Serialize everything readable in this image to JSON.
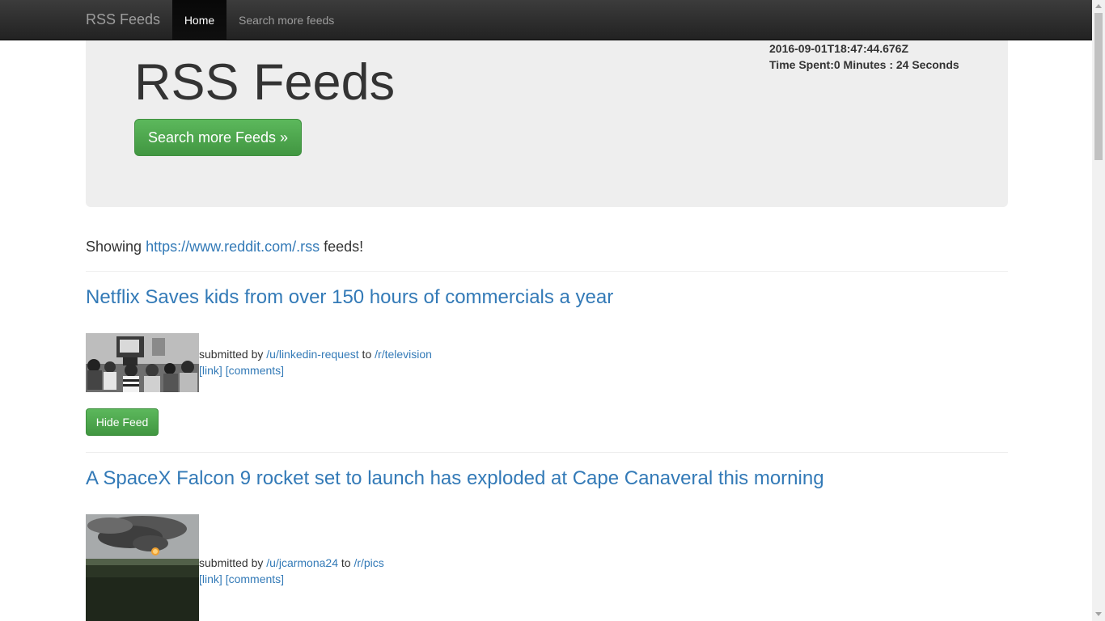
{
  "navbar": {
    "brand": "RSS Feeds",
    "home": "Home",
    "search": "Search more feeds"
  },
  "jumbotron": {
    "title": "RSS Feeds",
    "button": "Search more Feeds »",
    "timestamp": "2016-09-01T18:47:44.676Z",
    "time_spent": "Time Spent:0 Minutes : 24 Seconds"
  },
  "showing": {
    "prefix": "Showing ",
    "url": "https://www.reddit.com/.rss",
    "suffix": " feeds!"
  },
  "feeds": [
    {
      "title": "Netflix Saves kids from over 150 hours of commercials a year",
      "submitted_by": "submitted by ",
      "user": "/u/linkedin-request",
      "to": " to ",
      "subreddit": "/r/television",
      "link": "[link]",
      "comments": "[comments]",
      "hide": "Hide Feed",
      "thumbnail": "kids-watching-tv"
    },
    {
      "title": "A SpaceX Falcon 9 rocket set to launch has exploded at Cape Canaveral this morning",
      "submitted_by": "submitted by ",
      "user": "/u/jcarmona24",
      "to": " to ",
      "subreddit": "/r/pics",
      "link": "[link]",
      "comments": "[comments]",
      "thumbnail": "rocket-explosion-smoke"
    }
  ]
}
